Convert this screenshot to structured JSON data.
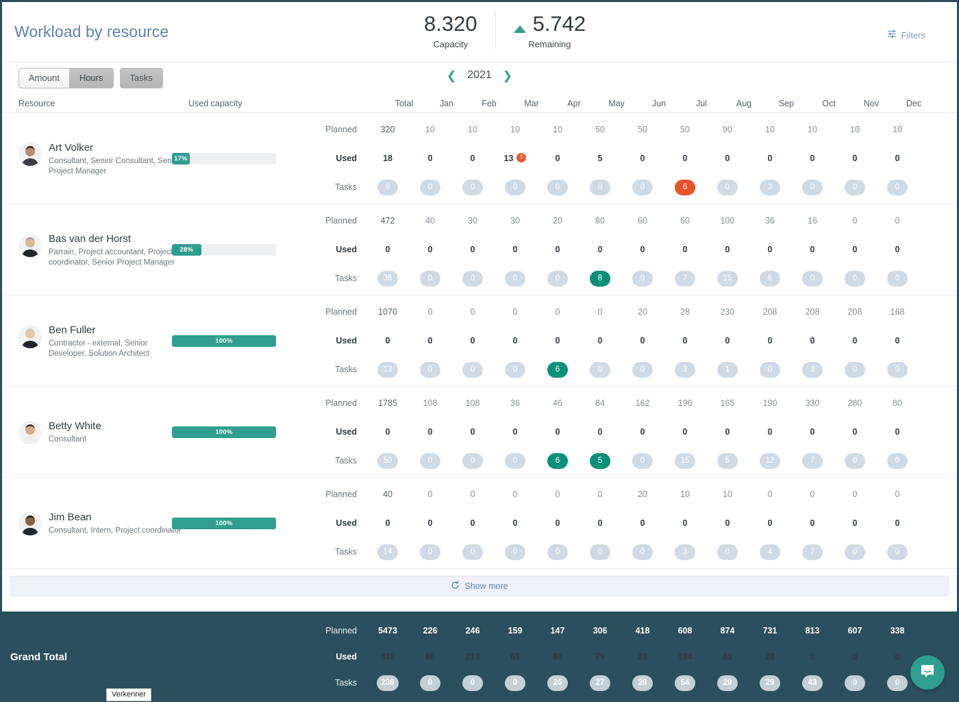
{
  "header": {
    "title": "Workload by resource",
    "kpis": [
      {
        "value": "8.320",
        "label": "Capacity",
        "trend": false
      },
      {
        "value": "5.742",
        "label": "Remaining",
        "trend": true
      }
    ],
    "filters_label": "Filters",
    "filters_icon": "filter-sliders-icon"
  },
  "toolbar": {
    "buttons": [
      {
        "label": "Amount",
        "active": false
      },
      {
        "label": "Hours",
        "active": true
      },
      {
        "label": "Tasks",
        "active": true
      }
    ],
    "year": "2021",
    "prev_icon": "chevron-left-icon",
    "next_icon": "chevron-right-icon"
  },
  "columns": {
    "resource": "Resource",
    "used_capacity": "Used capacity",
    "total": "Total",
    "months": [
      "Jan",
      "Feb",
      "Mar",
      "Apr",
      "May",
      "Jun",
      "Jul",
      "Aug",
      "Sep",
      "Oct",
      "Nov",
      "Dec"
    ]
  },
  "row_labels": {
    "planned": "Planned",
    "used": "Used",
    "tasks": "Tasks"
  },
  "accent_colors": {
    "teal": "#2f9e8f",
    "teal_dark": "#0a8f7b",
    "orange": "#e8552c",
    "pill_grey": "#cfdae6",
    "footer": "#2b4f5c",
    "title_blue": "#5b83ad"
  },
  "resources": [
    {
      "name": "Art Volker",
      "role": "Consultant, Senior Consultant, Senior Project Manager",
      "capacity_pct": "17%",
      "capacity_value": 17,
      "planned": {
        "total": "320",
        "months": [
          "10",
          "10",
          "10",
          "10",
          "50",
          "50",
          "50",
          "90",
          "10",
          "10",
          "10",
          "10"
        ]
      },
      "used": {
        "total": "18",
        "months": [
          "0",
          "0",
          "13",
          "0",
          "5",
          "0",
          "0",
          "0",
          "0",
          "0",
          "0",
          "0"
        ],
        "warning_month_index": 2
      },
      "tasks": {
        "total": "9",
        "months": [
          "0",
          "0",
          "0",
          "0",
          "0",
          "0",
          "6",
          "0",
          "3",
          "0",
          "0",
          "0"
        ],
        "highlights": {
          "6": "orange"
        }
      }
    },
    {
      "name": "Bas van der Horst",
      "role": "Parrain, Project accountant, Project coordinator, Senior Project Manager",
      "capacity_pct": "28%",
      "capacity_value": 28,
      "planned": {
        "total": "472",
        "months": [
          "40",
          "30",
          "30",
          "20",
          "80",
          "60",
          "60",
          "100",
          "36",
          "16",
          "0",
          "0"
        ]
      },
      "used": {
        "total": "0",
        "months": [
          "0",
          "0",
          "0",
          "0",
          "0",
          "0",
          "0",
          "0",
          "0",
          "0",
          "0",
          "0"
        ],
        "warning_month_index": null
      },
      "tasks": {
        "total": "36",
        "months": [
          "0",
          "0",
          "0",
          "0",
          "8",
          "0",
          "7",
          "15",
          "6",
          "0",
          "0",
          "0"
        ],
        "highlights": {
          "4": "green"
        }
      }
    },
    {
      "name": "Ben Fuller",
      "role": "Contractor - external, Senior Developer, Solution Architect",
      "capacity_pct": "100%",
      "capacity_value": 100,
      "planned": {
        "total": "1070",
        "months": [
          "0",
          "0",
          "0",
          "0",
          "0",
          "20",
          "28",
          "230",
          "208",
          "208",
          "208",
          "168"
        ]
      },
      "used": {
        "total": "0",
        "months": [
          "0",
          "0",
          "0",
          "0",
          "0",
          "0",
          "0",
          "0",
          "0",
          "0",
          "0",
          "0"
        ],
        "warning_month_index": null
      },
      "tasks": {
        "total": "13",
        "months": [
          "0",
          "0",
          "0",
          "6",
          "0",
          "0",
          "3",
          "1",
          "0",
          "3",
          "0",
          "0"
        ],
        "highlights": {
          "3": "green"
        }
      }
    },
    {
      "name": "Betty White",
      "role": "Consultant",
      "capacity_pct": "100%",
      "capacity_value": 100,
      "planned": {
        "total": "1785",
        "months": [
          "108",
          "108",
          "36",
          "46",
          "84",
          "162",
          "196",
          "165",
          "190",
          "330",
          "280",
          "80"
        ]
      },
      "used": {
        "total": "0",
        "months": [
          "0",
          "0",
          "0",
          "0",
          "0",
          "0",
          "0",
          "0",
          "0",
          "0",
          "0",
          "0"
        ],
        "warning_month_index": null
      },
      "tasks": {
        "total": "50",
        "months": [
          "0",
          "0",
          "0",
          "6",
          "5",
          "0",
          "15",
          "5",
          "12",
          "7",
          "0",
          "0"
        ],
        "highlights": {
          "3": "green",
          "4": "green"
        }
      }
    },
    {
      "name": "Jim Bean",
      "role": "Consultant, Intern, Project coordinator",
      "capacity_pct": "100%",
      "capacity_value": 100,
      "planned": {
        "total": "40",
        "months": [
          "0",
          "0",
          "0",
          "0",
          "0",
          "20",
          "10",
          "10",
          "0",
          "0",
          "0",
          "0"
        ]
      },
      "used": {
        "total": "0",
        "months": [
          "0",
          "0",
          "0",
          "0",
          "0",
          "0",
          "0",
          "0",
          "0",
          "0",
          "0",
          "0"
        ],
        "warning_month_index": null
      },
      "tasks": {
        "total": "14",
        "months": [
          "0",
          "0",
          "0",
          "0",
          "0",
          "0",
          "3",
          "0",
          "4",
          "7",
          "0",
          "0"
        ],
        "highlights": {}
      }
    }
  ],
  "show_more": {
    "label": "Show more",
    "icon": "refresh-icon"
  },
  "grand_total": {
    "label": "Grand Total",
    "planned": {
      "total": "5473",
      "months": [
        "226",
        "246",
        "159",
        "147",
        "306",
        "418",
        "608",
        "874",
        "731",
        "813",
        "607",
        "338"
      ]
    },
    "used": {
      "total": "839",
      "months": [
        "80",
        "213",
        "63",
        "80",
        "79",
        "23",
        "194",
        "81",
        "28",
        "0",
        "0",
        "0"
      ]
    },
    "tasks": {
      "total": "236",
      "months": [
        "0",
        "0",
        "0",
        "26",
        "27",
        "28",
        "54",
        "29",
        "29",
        "43",
        "0",
        "0"
      ]
    }
  },
  "chat": {
    "icon": "chat-bubble-icon"
  },
  "taskbar": {
    "tooltip": "Verkenner"
  }
}
